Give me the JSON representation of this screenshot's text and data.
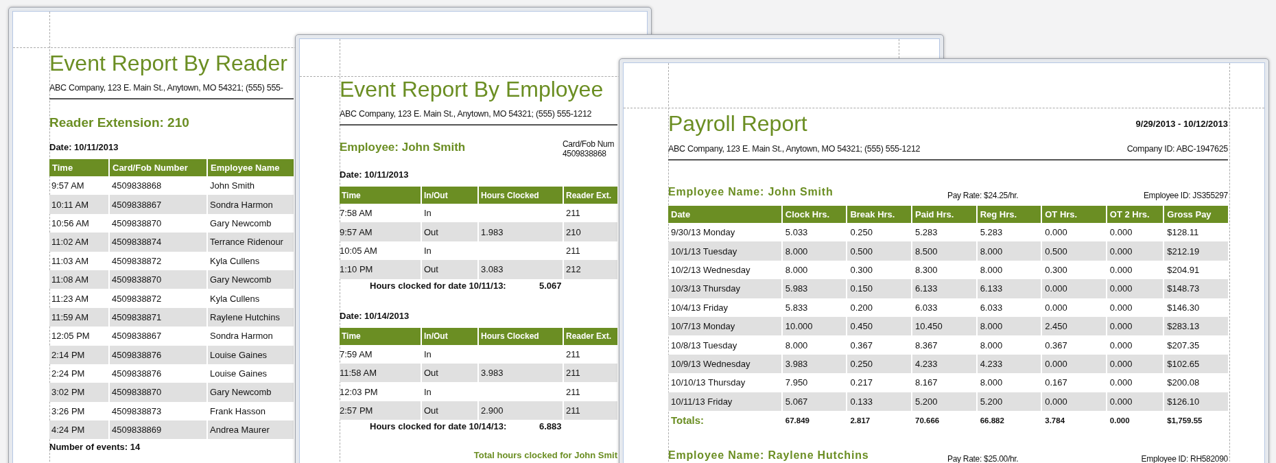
{
  "windows": [
    {
      "kind": "reader_report",
      "title": "Event Report By Reader",
      "company": "ABC Company, 123 E. Main St., Anytown, MO 54321; (555) 555-",
      "heading": "Reader Extension: 210",
      "date": "Date: 10/11/2013",
      "columns": [
        "Time",
        "Card/Fob Number",
        "Employee Name"
      ],
      "rows": [
        [
          "9:57 AM",
          "4509838868",
          "John Smith"
        ],
        [
          "10:11 AM",
          "4509838867",
          "Sondra Harmon"
        ],
        [
          "10:56 AM",
          "4509838870",
          "Gary Newcomb"
        ],
        [
          "11:02 AM",
          "4509838874",
          "Terrance Ridenour"
        ],
        [
          "11:03 AM",
          "4509838872",
          "Kyla Cullens"
        ],
        [
          "11:08 AM",
          "4509838870",
          "Gary Newcomb"
        ],
        [
          "11:23 AM",
          "4509838872",
          "Kyla Cullens"
        ],
        [
          "11:59 AM",
          "4509838871",
          "Raylene Hutchins"
        ],
        [
          "12:05 PM",
          "4509838867",
          "Sondra Harmon"
        ],
        [
          "2:14 PM",
          "4509838876",
          "Louise Gaines"
        ],
        [
          "2:24 PM",
          "4509838876",
          "Louise Gaines"
        ],
        [
          "3:02 PM",
          "4509838870",
          "Gary Newcomb"
        ],
        [
          "3:26 PM",
          "4509838873",
          "Frank Hasson"
        ],
        [
          "4:24 PM",
          "4509838869",
          "Andrea Maurer"
        ]
      ],
      "footer": "Number of events: 14"
    },
    {
      "kind": "employee_report",
      "title": "Event Report By Employee",
      "company": "ABC Company, 123 E. Main St., Anytown, MO 54321; (555) 555-1212",
      "employee": "Employee: John Smith",
      "card_label": "Card/Fob Num",
      "card_number": "4509838868",
      "sections": [
        {
          "date": "Date: 10/11/2013",
          "columns": [
            "Time",
            "In/Out",
            "Hours Clocked",
            "Reader Ext."
          ],
          "rows": [
            {
              "time": "7:58 AM",
              "direction": "In",
              "reader": "211"
            },
            {
              "time": "9:57 AM",
              "direction": "Out",
              "hours": "1.983",
              "reader": "210"
            },
            {
              "time": "10:05 AM",
              "direction": "In",
              "reader": "211"
            },
            {
              "time": "1:10 PM",
              "direction": "Out",
              "hours": "3.083",
              "reader": "212"
            }
          ],
          "summary_label": "Hours clocked for date 10/11/13:",
          "summary_value": "5.067"
        },
        {
          "date": "Date: 10/14/2013",
          "columns": [
            "Time",
            "In/Out",
            "Hours Clocked",
            "Reader Ext."
          ],
          "rows": [
            {
              "time": "7:59 AM",
              "direction": "In",
              "reader": "211"
            },
            {
              "time": "11:58 AM",
              "direction": "Out",
              "hours": "3.983",
              "reader": "211"
            },
            {
              "time": "12:03 PM",
              "direction": "In",
              "reader": "211"
            },
            {
              "time": "2:57 PM",
              "direction": "Out",
              "hours": "2.900",
              "reader": "211"
            }
          ],
          "summary_label": "Hours clocked for date 10/14/13:",
          "summary_value": "6.883"
        }
      ],
      "total": "Total hours clocked for John Smit"
    },
    {
      "kind": "payroll_report",
      "title": "Payroll Report",
      "date_range": "9/29/2013 - 10/12/2013",
      "company": "ABC Company, 123 E. Main St., Anytown, MO 54321; (555) 555-1212",
      "company_id": "Company ID: ABC-1947625",
      "employees": [
        {
          "name": "Employee Name: John Smith",
          "pay_rate": "Pay Rate: $24.25/hr.",
          "employee_id": "Employee ID: JS355297",
          "columns": [
            "Date",
            "Clock Hrs.",
            "Break Hrs.",
            "Paid Hrs.",
            "Reg Hrs.",
            "OT Hrs.",
            "OT 2 Hrs.",
            "Gross Pay"
          ],
          "rows": [
            [
              "9/30/13 Monday",
              "5.033",
              "0.250",
              "5.283",
              "5.283",
              "0.000",
              "0.000",
              "$128.11"
            ],
            [
              "10/1/13 Tuesday",
              "8.000",
              "0.500",
              "8.500",
              "8.000",
              "0.500",
              "0.000",
              "$212.19"
            ],
            [
              "10/2/13 Wednesday",
              "8.000",
              "0.300",
              "8.300",
              "8.000",
              "0.300",
              "0.000",
              "$204.91"
            ],
            [
              "10/3/13 Thursday",
              "5.983",
              "0.150",
              "6.133",
              "6.133",
              "0.000",
              "0.000",
              "$148.73"
            ],
            [
              "10/4/13 Friday",
              "5.833",
              "0.200",
              "6.033",
              "6.033",
              "0.000",
              "0.000",
              "$146.30"
            ],
            [
              "10/7/13 Monday",
              "10.000",
              "0.450",
              "10.450",
              "8.000",
              "2.450",
              "0.000",
              "$283.13"
            ],
            [
              "10/8/13 Tuesday",
              "8.000",
              "0.367",
              "8.367",
              "8.000",
              "0.367",
              "0.000",
              "$207.35"
            ],
            [
              "10/9/13 Wednesday",
              "3.983",
              "0.250",
              "4.233",
              "4.233",
              "0.000",
              "0.000",
              "$102.65"
            ],
            [
              "10/10/13 Thursday",
              "7.950",
              "0.217",
              "8.167",
              "8.000",
              "0.167",
              "0.000",
              "$200.08"
            ],
            [
              "10/11/13 Friday",
              "5.067",
              "0.133",
              "5.200",
              "5.200",
              "0.000",
              "0.000",
              "$126.10"
            ]
          ],
          "totals_label": "Totals:",
          "totals": [
            "67.849",
            "2.817",
            "70.666",
            "66.882",
            "3.784",
            "0.000",
            "$1,759.55"
          ]
        },
        {
          "name": "Employee Name: Raylene Hutchins",
          "pay_rate": "Pay Rate: $25.00/hr.",
          "employee_id": "Employee ID: RH582090"
        }
      ]
    }
  ]
}
